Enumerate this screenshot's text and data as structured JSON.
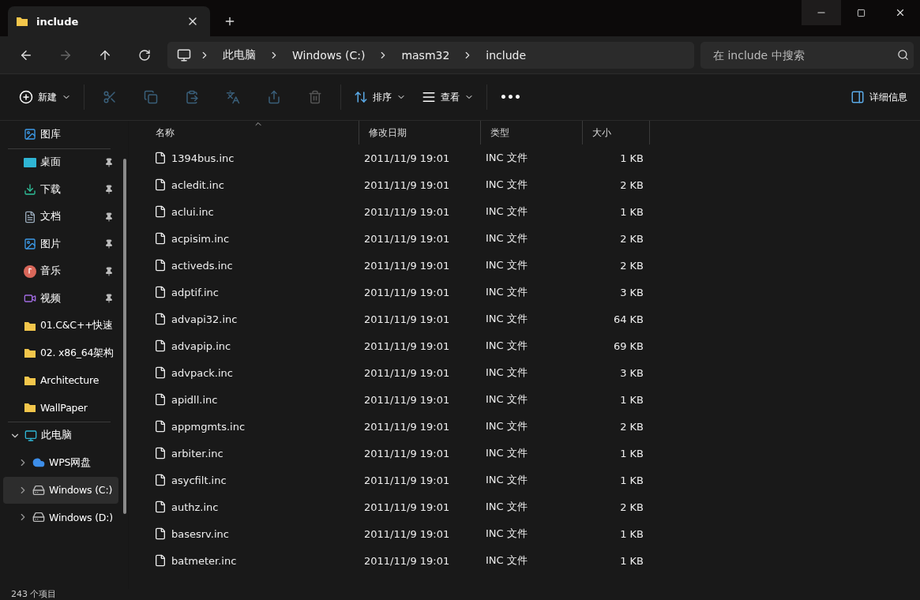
{
  "tab": {
    "title": "include",
    "selected": true
  },
  "address_bar": {
    "crumbs": [
      "此电脑",
      "Windows (C:)",
      "masm32",
      "include"
    ]
  },
  "search": {
    "placeholder": "在 include 中搜索"
  },
  "toolbar": {
    "new": "新建",
    "sort": "排序",
    "view": "查看",
    "more": "•••",
    "details": "详细信息"
  },
  "sidebar": {
    "sections": [
      [
        {
          "label": "图库",
          "kind": "gallery",
          "pinned": false
        }
      ],
      [
        {
          "label": "桌面",
          "kind": "desktop",
          "pinned": true
        },
        {
          "label": "下载",
          "kind": "downloads",
          "pinned": true
        },
        {
          "label": "文档",
          "kind": "documents",
          "pinned": true
        },
        {
          "label": "图片",
          "kind": "pictures",
          "pinned": true
        },
        {
          "label": "音乐",
          "kind": "music",
          "pinned": true
        },
        {
          "label": "视频",
          "kind": "videos",
          "pinned": true
        },
        {
          "label": "01.C&C++快速",
          "kind": "folder",
          "pinned": false
        },
        {
          "label": "02. x86_64架构",
          "kind": "folder",
          "pinned": false
        },
        {
          "label": "Architecture",
          "kind": "folder",
          "pinned": false
        },
        {
          "label": "WallPaper",
          "kind": "folder",
          "pinned": false
        }
      ]
    ],
    "tree": {
      "label": "此电脑",
      "expanded": true,
      "children": [
        {
          "label": "WPS网盘",
          "kind": "cloud",
          "expanded": false,
          "selected": false
        },
        {
          "label": "Windows (C:)",
          "kind": "drive",
          "expanded": false,
          "selected": true
        },
        {
          "label": "Windows (D:)",
          "kind": "drive",
          "expanded": false,
          "selected": false
        }
      ]
    }
  },
  "table": {
    "columns": [
      {
        "label": "名称",
        "sorted": true
      },
      {
        "label": "修改日期",
        "sorted": false
      },
      {
        "label": "类型",
        "sorted": false
      },
      {
        "label": "大小",
        "sorted": false
      }
    ],
    "rows": [
      [
        "1394bus.inc",
        "2011/11/9 19:01",
        "INC 文件",
        "1 KB"
      ],
      [
        "acledit.inc",
        "2011/11/9 19:01",
        "INC 文件",
        "2 KB"
      ],
      [
        "aclui.inc",
        "2011/11/9 19:01",
        "INC 文件",
        "1 KB"
      ],
      [
        "acpisim.inc",
        "2011/11/9 19:01",
        "INC 文件",
        "2 KB"
      ],
      [
        "activeds.inc",
        "2011/11/9 19:01",
        "INC 文件",
        "2 KB"
      ],
      [
        "adptif.inc",
        "2011/11/9 19:01",
        "INC 文件",
        "3 KB"
      ],
      [
        "advapi32.inc",
        "2011/11/9 19:01",
        "INC 文件",
        "64 KB"
      ],
      [
        "advapip.inc",
        "2011/11/9 19:01",
        "INC 文件",
        "69 KB"
      ],
      [
        "advpack.inc",
        "2011/11/9 19:01",
        "INC 文件",
        "3 KB"
      ],
      [
        "apidll.inc",
        "2011/11/9 19:01",
        "INC 文件",
        "1 KB"
      ],
      [
        "appmgmts.inc",
        "2011/11/9 19:01",
        "INC 文件",
        "2 KB"
      ],
      [
        "arbiter.inc",
        "2011/11/9 19:01",
        "INC 文件",
        "1 KB"
      ],
      [
        "asycfilt.inc",
        "2011/11/9 19:01",
        "INC 文件",
        "1 KB"
      ],
      [
        "authz.inc",
        "2011/11/9 19:01",
        "INC 文件",
        "2 KB"
      ],
      [
        "basesrv.inc",
        "2011/11/9 19:01",
        "INC 文件",
        "1 KB"
      ],
      [
        "batmeter.inc",
        "2011/11/9 19:01",
        "INC 文件",
        "1 KB"
      ]
    ]
  },
  "status_bar": {
    "text": "243 个项目"
  }
}
